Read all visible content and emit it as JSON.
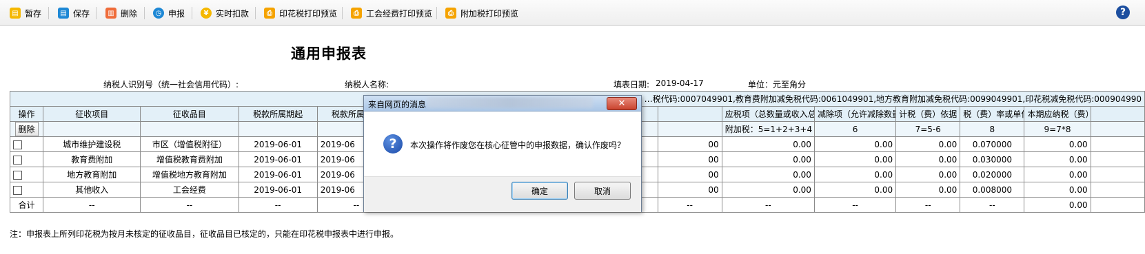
{
  "toolbar": {
    "items": [
      {
        "label": "暂存",
        "icon": "save-draft-icon",
        "color": "#f5b800"
      },
      {
        "label": "保存",
        "icon": "save-icon",
        "color": "#1e88d5"
      },
      {
        "label": "删除",
        "icon": "delete-icon",
        "color": "#ef6c3a"
      },
      {
        "label": "申报",
        "icon": "declare-icon",
        "color": "#1e88d5"
      },
      {
        "label": "实时扣款",
        "icon": "payment-icon",
        "color": "#f5b800"
      },
      {
        "label": "印花税打印预览",
        "icon": "print-icon",
        "color": "#f5a300"
      },
      {
        "label": "工会经费打印预览",
        "icon": "print-icon",
        "color": "#f5a300"
      },
      {
        "label": "附加税打印预览",
        "icon": "print-icon",
        "color": "#f5a300"
      }
    ],
    "help": "?"
  },
  "form": {
    "title": "通用申报表",
    "taxpayer_id_label": "纳税人识别号（统一社会信用代码）:",
    "taxpayer_name_label": "纳税人名称:",
    "fill_date_label": "填表日期:",
    "fill_date": "2019-04-17",
    "unit_label": "单位：元至角分"
  },
  "notice": "…税代码:0007049901,教育费附加减免税代码:0061049901,地方教育附加减免税代码:0099049901,印花税减免税代码:000904990",
  "table": {
    "headers": [
      "操作",
      "征收项目",
      "征收品目",
      "税款所属期起",
      "税款所属期止",
      "",
      "",
      "",
      "",
      "",
      "应税项（总数量或收入总额、应缴费人数、原值、面积、缴费基数等）",
      "减除项（允许减除数量、金额、面积、已安排残疾人数等）",
      "计税（费）依据",
      "税（费）率或单位税额",
      "本期应纳税（费）额"
    ],
    "formula_row": {
      "op": "删除",
      "applicable": "附加税：5=1+2+3+4",
      "deduction": "6",
      "basis": "7=5-6",
      "rate": "8",
      "payable": "9=7*8"
    },
    "rows": [
      {
        "item": "城市维护建设税",
        "subitem": "市区（增值税附征）",
        "start": "2019-06-01",
        "end": "2019-06",
        "hidden_tail": "00",
        "applicable": "0.00",
        "deduction": "0.00",
        "basis": "0.00",
        "rate": "0.070000",
        "payable": "0.00"
      },
      {
        "item": "教育费附加",
        "subitem": "增值税教育费附加",
        "start": "2019-06-01",
        "end": "2019-06",
        "hidden_tail": "00",
        "applicable": "0.00",
        "deduction": "0.00",
        "basis": "0.00",
        "rate": "0.030000",
        "payable": "0.00"
      },
      {
        "item": "地方教育附加",
        "subitem": "增值税地方教育附加",
        "start": "2019-06-01",
        "end": "2019-06",
        "hidden_tail": "00",
        "applicable": "0.00",
        "deduction": "0.00",
        "basis": "0.00",
        "rate": "0.020000",
        "payable": "0.00"
      },
      {
        "item": "其他收入",
        "subitem": "工会经费",
        "start": "2019-06-01",
        "end": "2019-06",
        "hidden_tail": "00",
        "applicable": "0.00",
        "deduction": "0.00",
        "basis": "0.00",
        "rate": "0.008000",
        "payable": "0.00"
      }
    ],
    "total_row": {
      "label": "合计",
      "dash": "--",
      "payable": "0.00"
    }
  },
  "footnote": "注：申报表上所列印花税为按月未核定的征收品目，征收品目已核定的，只能在印花税申报表中进行申报。",
  "dialog": {
    "title": "来自网页的消息",
    "message": "本次操作将作废您在核心征管中的申报数据，确认作废吗？",
    "ok": "确定",
    "cancel": "取消",
    "close": "✕"
  }
}
